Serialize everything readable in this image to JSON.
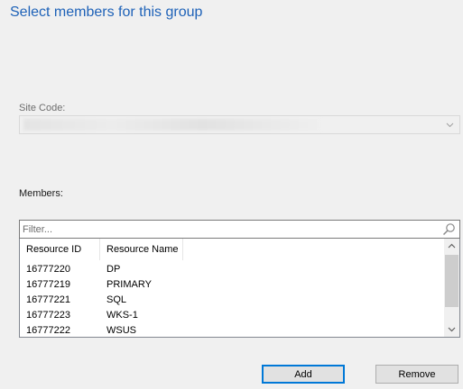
{
  "dialog": {
    "title": "Select members for this group"
  },
  "site_code": {
    "label": "Site Code:",
    "value": ""
  },
  "members": {
    "label": "Members:",
    "filter_placeholder": "Filter...",
    "filter_value": "",
    "columns": [
      "Resource ID",
      "Resource Name"
    ],
    "rows": [
      {
        "id": "16777220",
        "name": "DP"
      },
      {
        "id": "16777219",
        "name": "PRIMARY"
      },
      {
        "id": "16777221",
        "name": "SQL"
      },
      {
        "id": "16777223",
        "name": "WKS-1"
      },
      {
        "id": "16777222",
        "name": "WSUS"
      }
    ]
  },
  "buttons": {
    "add_label": "Add",
    "remove_label": "Remove"
  },
  "icons": {
    "combo_arrow": "chevron-down-icon",
    "filter_search": "search-icon",
    "scroll_up": "scroll-up-arrow-icon",
    "scroll_down": "scroll-down-arrow-icon"
  },
  "colors": {
    "title": "#1e62b8",
    "default_button_border": "#0078d7"
  }
}
